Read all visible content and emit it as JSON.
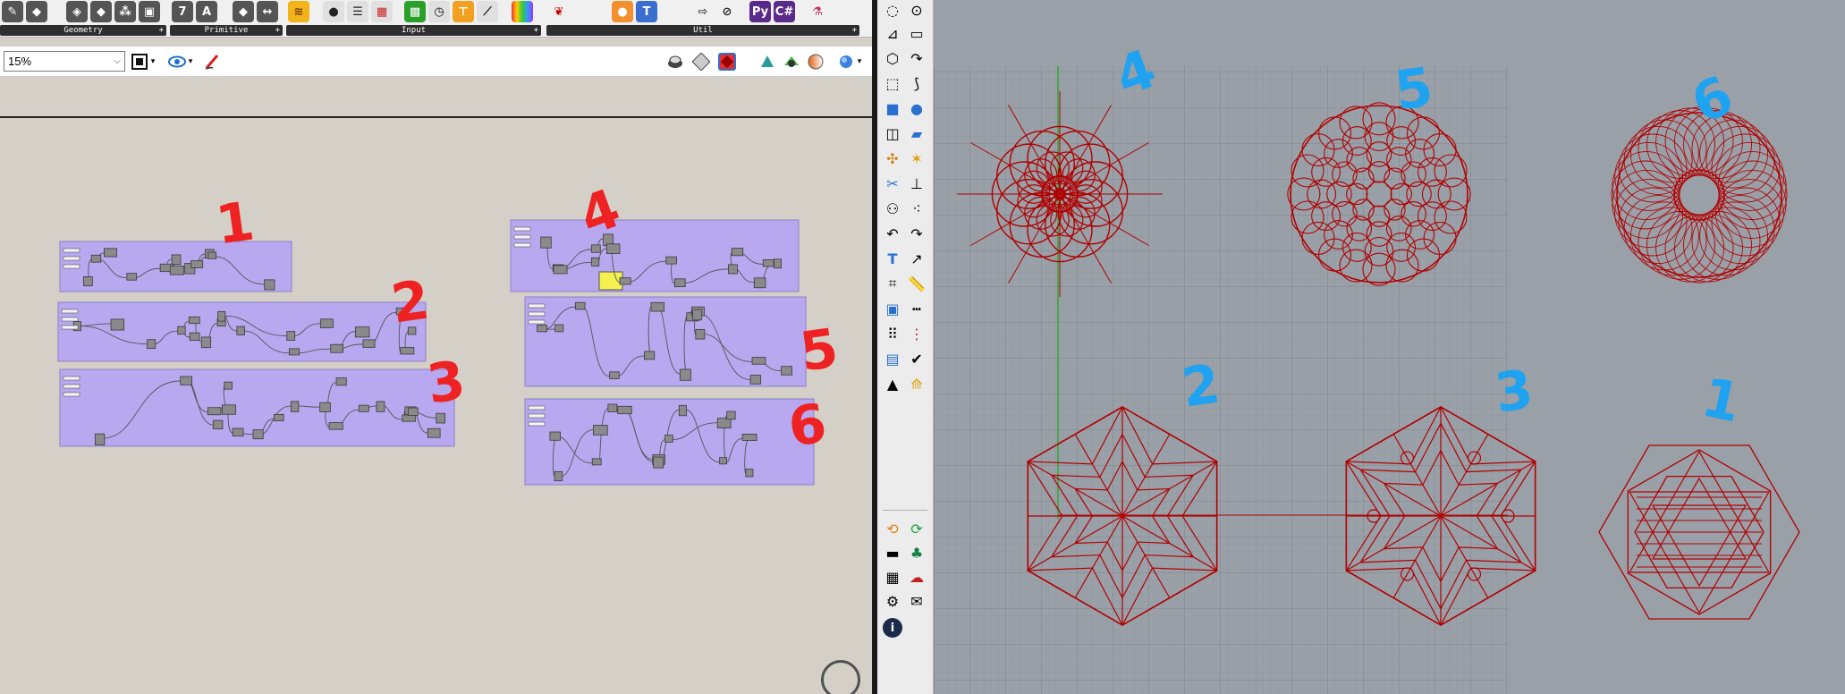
{
  "ribbon": {
    "groups": [
      {
        "label": "Geometry"
      },
      {
        "label": "Primitive"
      },
      {
        "label": "Input"
      },
      {
        "label": "Util"
      }
    ]
  },
  "toolbar": {
    "zoom_value": "15%"
  },
  "canvas": {
    "annotations": [
      "1",
      "2",
      "3",
      "4",
      "5",
      "6"
    ]
  },
  "viewport": {
    "labels": [
      "4",
      "5",
      "6",
      "2",
      "3",
      "1"
    ]
  },
  "colors": {
    "group_fill": "#b8a8f0",
    "red_annotation": "#ee2222",
    "blue_annotation": "#1fa2f0",
    "curve_red": "#b00000",
    "viewport_bg": "#9aa0a8"
  }
}
